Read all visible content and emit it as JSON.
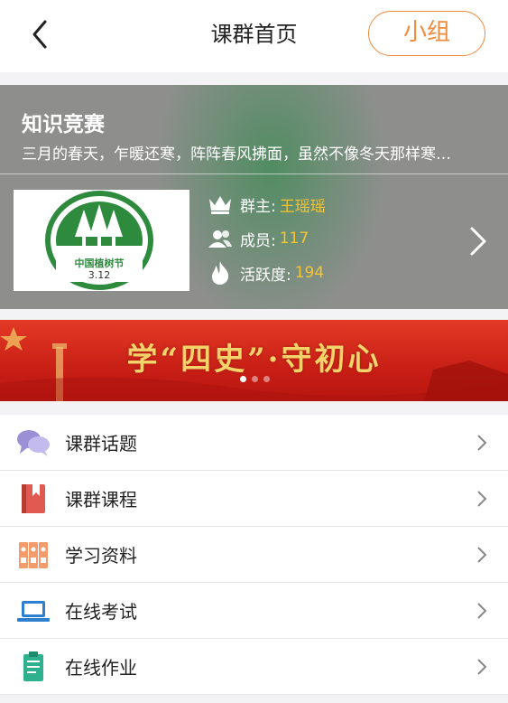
{
  "header": {
    "title": "课群首页",
    "group_button": "小组",
    "back_icon": "chevron-left-icon"
  },
  "group": {
    "name": "知识竞赛",
    "description": "三月的春天，乍暖还寒，阵阵春风拂面，虽然不像冬天那样寒…",
    "logo": {
      "caption_line1": "中国植树节",
      "caption_line2": "3.12"
    },
    "owner_label": "群主:",
    "owner_value": "王瑶瑶",
    "members_label": "成员:",
    "members_value": "117",
    "activity_label": "活跃度:",
    "activity_value": "194"
  },
  "promo": {
    "text": "学“四史”·守初心",
    "slides": 3,
    "active_slide": 1
  },
  "menu": {
    "items": [
      {
        "label": "课群话题",
        "icon": "chat-bubbles-icon"
      },
      {
        "label": "课群课程",
        "icon": "book-icon"
      },
      {
        "label": "学习资料",
        "icon": "binders-icon"
      },
      {
        "label": "在线考试",
        "icon": "laptop-icon"
      },
      {
        "label": "在线作业",
        "icon": "clipboard-icon"
      }
    ]
  },
  "colors": {
    "accent_orange": "#f08a3c",
    "highlight_yellow": "#f5c433",
    "banner_gray": "#8e8f8d",
    "promo_red": "#d42a1e"
  }
}
